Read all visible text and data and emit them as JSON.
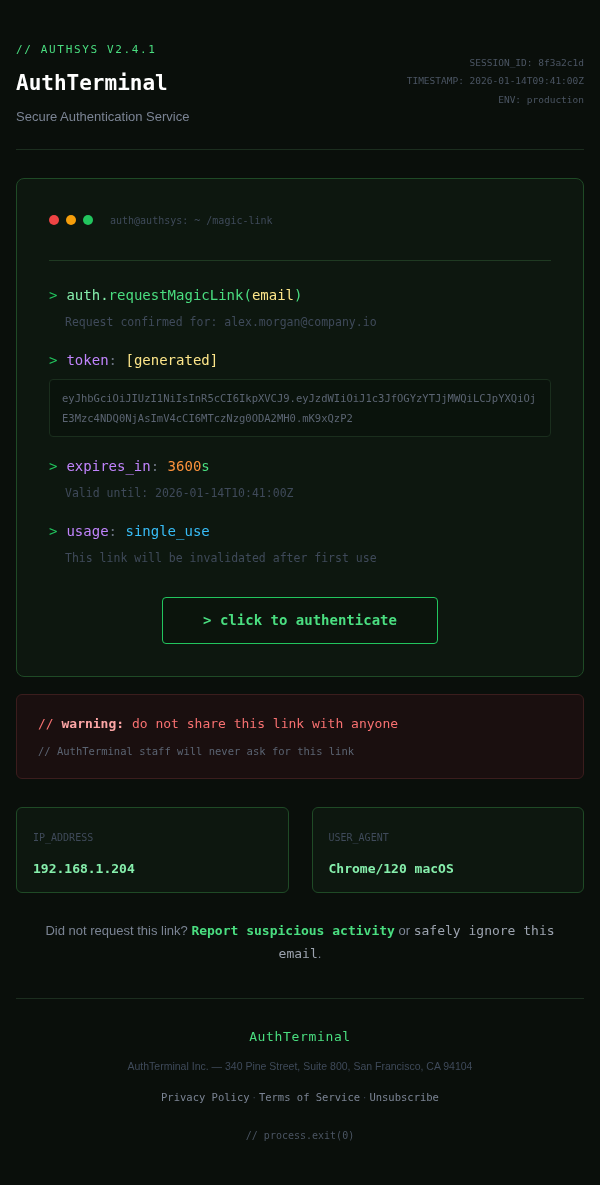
{
  "header": {
    "version": "// AUTHSYS V2.4.1",
    "title": "AuthTerminal",
    "subtitle": "Secure Authentication Service",
    "meta": [
      "SESSION_ID: 8f3a2c1d",
      "TIMESTAMP: 2026-01-14T09:41:00Z",
      "ENV: production"
    ]
  },
  "terminal": {
    "dots": [
      {
        "color": "#ef4444"
      },
      {
        "color": "#f59e0b"
      },
      {
        "color": "#22c55e"
      }
    ],
    "path": "auth@authsys: ~ /magic-link",
    "commands": [
      {
        "prompt": ">",
        "parts": [
          {
            "kind": "object",
            "text": "auth."
          },
          {
            "kind": "method",
            "text": "requestMagicLink("
          },
          {
            "kind": "string",
            "text": "email"
          },
          {
            "kind": "method",
            "text": ")"
          }
        ],
        "note": "Request confirmed for: alex.morgan@company.io"
      },
      {
        "prompt": ">",
        "parts": [
          {
            "kind": "key",
            "text": "token"
          },
          {
            "kind": "punct",
            "text": ": "
          },
          {
            "kind": "string",
            "text": "[generated]"
          }
        ],
        "token": "eyJhbGciOiJIUzI1NiIsInR5cCI6IkpXVCJ9.eyJzdWIiOiJ1c3JfOGYzYTJjMWQiLCJpYXQiOjE3Mzc4NDQ0NjAsImV4cCI6MTczNzg0ODA2MH0.mK9xQzP2"
      },
      {
        "prompt": ">",
        "parts": [
          {
            "kind": "key",
            "text": "expires_in"
          },
          {
            "kind": "punct",
            "text": ": "
          },
          {
            "kind": "number",
            "text": "3600"
          },
          {
            "kind": "method",
            "text": "s"
          }
        ],
        "note": "Valid until: 2026-01-14T10:41:00Z"
      },
      {
        "prompt": ">",
        "parts": [
          {
            "kind": "key",
            "text": "usage"
          },
          {
            "kind": "punct",
            "text": ": "
          },
          {
            "kind": "enum",
            "text": "single_use"
          }
        ],
        "note": "This link will be invalidated after first use"
      }
    ],
    "button": "> click to authenticate"
  },
  "warning": {
    "line": "// **warning:** do not share this link with anyone",
    "note": "// AuthTerminal staff will never ask for this link"
  },
  "info_cards": [
    {
      "label": "IP_ADDRESS",
      "value": "192.168.1.204"
    },
    {
      "label": "USER_AGENT",
      "value": "Chrome/120 macOS"
    }
  ],
  "notice": [
    {
      "kind": "text",
      "text": "Did not request this link? "
    },
    {
      "kind": "link",
      "text": "Report suspicious activity"
    },
    {
      "kind": "text",
      "text": " or "
    },
    {
      "kind": "code",
      "text": "safely ignore this email"
    },
    {
      "kind": "text",
      "text": "."
    }
  ],
  "footer": {
    "brand": "AuthTerminal",
    "address": "AuthTerminal Inc. — 340 Pine Street, Suite 800, San Francisco, CA 94104",
    "links": [
      "Privacy Policy",
      "Terms of Service",
      "Unsubscribe"
    ],
    "separator": "·",
    "exit": "// process.exit(0)"
  }
}
